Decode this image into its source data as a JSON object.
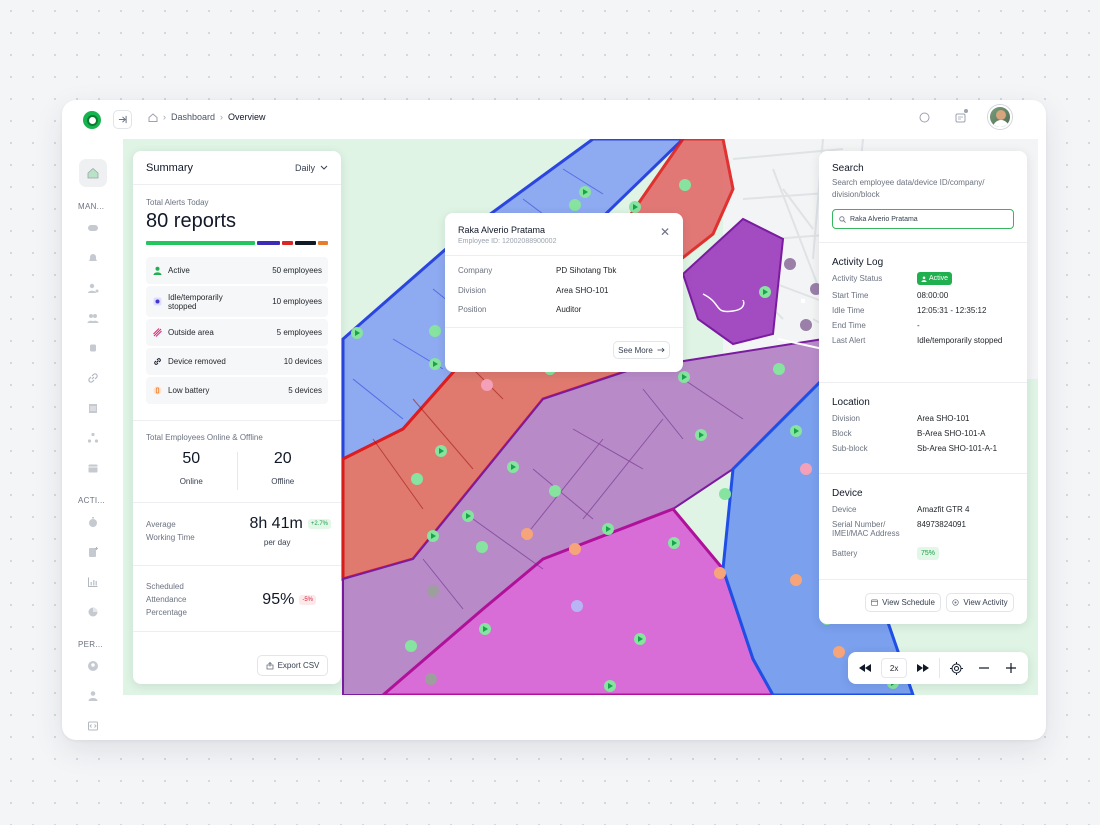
{
  "breadcrumb": {
    "items": [
      "Dashboard",
      "Overview"
    ]
  },
  "sidebar": {
    "section_manage": "MAN...",
    "section_activity": "ACTI...",
    "section_personal": "PER...",
    "icons": [
      "home-icon",
      "monitor-icon",
      "bell-icon",
      "user-location-icon",
      "users-icon",
      "watch-icon",
      "link-icon",
      "building-icon",
      "hierarchy-icon",
      "calendar-icon",
      "timer-icon",
      "add-document-icon",
      "chart-icon",
      "report-icon",
      "profile-icon",
      "person-icon",
      "code-icon"
    ]
  },
  "summary": {
    "title": "Summary",
    "period": "Daily",
    "alerts_label": "Total Alerts Today",
    "alerts_value": "80 reports",
    "alert_bar_colors": [
      "#22c55e",
      "#3b2bb5",
      "#dc2626",
      "#111827",
      "#ea7b2c"
    ],
    "alert_bar_share": [
      0.63,
      0.13,
      0.06,
      0.12,
      0.06
    ],
    "rows": [
      {
        "label": "Active",
        "value": "50 employees",
        "icon": "person-active-icon",
        "color": "#21b04f"
      },
      {
        "label": "Idle/temporarily stopped",
        "value": "10 employees",
        "icon": "idle-icon",
        "color": "#4338ca"
      },
      {
        "label": "Outside area",
        "value": "5 employees",
        "icon": "outside-area-icon",
        "color": "#db2777"
      },
      {
        "label": "Device removed",
        "value": "10 devices",
        "icon": "link-broken-icon",
        "color": "#111827"
      },
      {
        "label": "Low battery",
        "value": "5 devices",
        "icon": "low-battery-icon",
        "color": "#ea7b2c"
      }
    ],
    "online_offline_label": "Total Employees Online & Offline",
    "online_value": "50",
    "online_label": "Online",
    "offline_value": "20",
    "offline_label": "Offline",
    "avg_label_1": "Average",
    "avg_label_2": "Working Time",
    "avg_value": "8h 41m",
    "avg_change": "+2.7%",
    "avg_unit": "per day",
    "sched_label_1": "Scheduled",
    "sched_label_2": "Attendance",
    "sched_label_3": "Percentage",
    "sched_value": "95%",
    "sched_change": "-5%",
    "export_label": "Export CSV"
  },
  "popup": {
    "name": "Raka Alverio Pratama",
    "employee_id": "Employee ID: 12002088900002",
    "rows": [
      {
        "k": "Company",
        "v": "PD Sihotang Tbk"
      },
      {
        "k": "Division",
        "v": "Area SHO-101"
      },
      {
        "k": "Position",
        "v": "Auditor"
      }
    ],
    "see_more": "See More"
  },
  "detail": {
    "search_title": "Search",
    "search_hint": "Search employee data/device ID/company/ division/block",
    "search_value": "Raka Alverio Pratama",
    "activity_title": "Activity Log",
    "activity": [
      {
        "k": "Activity Status",
        "v": "Active"
      },
      {
        "k": "Start Time",
        "v": "08:00:00"
      },
      {
        "k": "Idle Time",
        "v": "12:05:31 - 12:35:12"
      },
      {
        "k": "End Time",
        "v": "-"
      },
      {
        "k": "Last Alert",
        "v": "Idle/temporarily stopped"
      }
    ],
    "location_title": "Location",
    "location": [
      {
        "k": "Division",
        "v": "Area SHO-101"
      },
      {
        "k": "Block",
        "v": "B-Area SHO-101-A"
      },
      {
        "k": "Sub-block",
        "v": "Sb-Area SHO-101-A-1"
      }
    ],
    "device_title": "Device",
    "device": [
      {
        "k": "Device",
        "v": "Amazfit GTR 4"
      },
      {
        "k": "Serial Number/ IMEI/MAC Address",
        "v": "84973824091"
      },
      {
        "k": "Battery",
        "v": "75%"
      }
    ],
    "view_schedule": "View Schedule",
    "view_activity": "View Activity"
  },
  "playback": {
    "speed": "2x"
  }
}
